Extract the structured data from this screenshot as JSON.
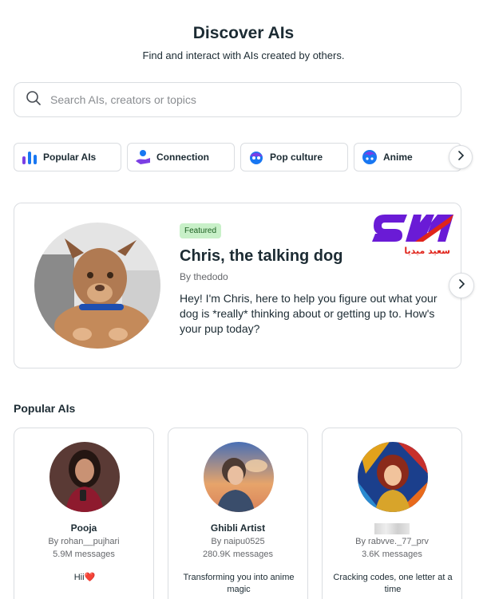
{
  "header": {
    "title": "Discover AIs",
    "subtitle": "Find and interact with AIs created by others."
  },
  "search": {
    "placeholder": "Search AIs, creators or topics",
    "value": ""
  },
  "categories": [
    {
      "label": "Popular AIs",
      "icon": "bar-chart-icon"
    },
    {
      "label": "Connection",
      "icon": "connection-icon"
    },
    {
      "label": "Pop culture",
      "icon": "pop-culture-icon"
    },
    {
      "label": "Anime",
      "icon": "anime-icon"
    }
  ],
  "featured": {
    "badge": "Featured",
    "name": "Chris, the talking dog",
    "creator": "By thedodo",
    "description": "Hey! I'm Chris, here to help you figure out what your dog is *really* thinking about or getting up to. How's your pup today?",
    "watermark_text": "سعيد ميديا"
  },
  "popular": {
    "title": "Popular AIs",
    "cards": [
      {
        "name": "Pooja",
        "creator": "By rohan__pujhari",
        "messages": "5.9M messages",
        "description": "Hii❤️"
      },
      {
        "name": "Ghibli Artist",
        "creator": "By naipu0525",
        "messages": "280.9K messages",
        "description": "Transforming you into anime magic"
      },
      {
        "name": "",
        "creator": "By rabvve._77_prv",
        "messages": "3.6K messages",
        "description": "Cracking codes, one letter at a time"
      }
    ]
  },
  "colors": {
    "accent_blue": "#1877f2",
    "logo_purple": "#6a1bd6",
    "logo_red": "#e0241b",
    "badge_green": "#c8f0c8"
  }
}
